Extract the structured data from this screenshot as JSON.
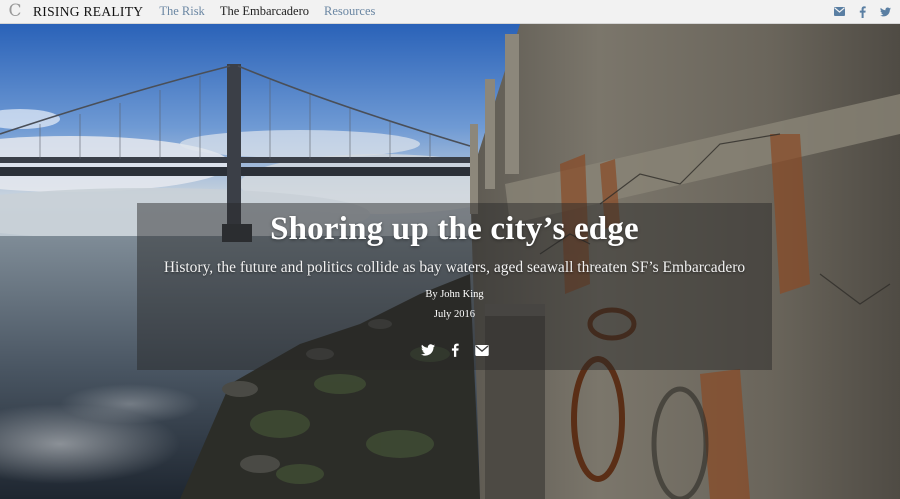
{
  "nav": {
    "logo_glyph": "C",
    "brand": "Rising Reality",
    "links": [
      {
        "label": "The Risk",
        "active": false
      },
      {
        "label": "The Embarcadero",
        "active": true
      },
      {
        "label": "Resources",
        "active": false
      }
    ],
    "share_icons": [
      "envelope-icon",
      "facebook-icon",
      "twitter-icon"
    ]
  },
  "hero": {
    "headline": "Shoring up the city’s edge",
    "dek": "History, the future and politics collide as bay waters, aged seawall threaten SF’s Embarcadero",
    "byline": "By John King",
    "date": "July 2016",
    "share_icons": [
      "twitter-icon",
      "facebook-icon",
      "envelope-icon"
    ]
  },
  "colors": {
    "nav_bg": "#f2f2f2",
    "nav_link": "#6b87a3",
    "nav_link_active": "#222222",
    "icon": "#5a7fa3",
    "overlay": "rgba(40,40,40,0.48)"
  }
}
